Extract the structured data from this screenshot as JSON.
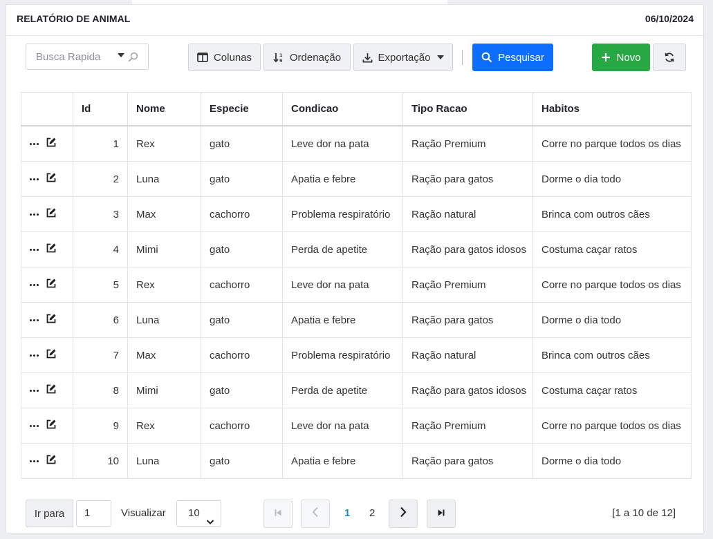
{
  "header": {
    "title": "RELATÓRIO DE ANIMAL",
    "date": "06/10/2024"
  },
  "toolbar": {
    "search_placeholder": "Busca Rapida",
    "columns_label": "Colunas",
    "order_label": "Ordenação",
    "export_label": "Exportação",
    "search_label": "Pesquisar",
    "new_label": "Novo"
  },
  "table": {
    "columns": [
      "Id",
      "Nome",
      "Especie",
      "Condicao",
      "Tipo Racao",
      "Habitos"
    ],
    "rows": [
      [
        "1",
        "Rex",
        "gato",
        "Leve dor na pata",
        "Ração Premium",
        "Corre no parque todos os dias"
      ],
      [
        "2",
        "Luna",
        "gato",
        "Apatia e febre",
        "Ração para gatos",
        "Dorme o dia todo"
      ],
      [
        "3",
        "Max",
        "cachorro",
        "Problema respiratório",
        "Ração natural",
        "Brinca com outros cães"
      ],
      [
        "4",
        "Mimi",
        "gato",
        "Perda de apetite",
        "Ração para gatos idosos",
        "Costuma caçar ratos"
      ],
      [
        "5",
        "Rex",
        "cachorro",
        "Leve dor na pata",
        "Ração Premium",
        "Corre no parque todos os dias"
      ],
      [
        "6",
        "Luna",
        "gato",
        "Apatia e febre",
        "Ração para gatos",
        "Dorme o dia todo"
      ],
      [
        "7",
        "Max",
        "cachorro",
        "Problema respiratório",
        "Ração natural",
        "Brinca com outros cães"
      ],
      [
        "8",
        "Mimi",
        "gato",
        "Perda de apetite",
        "Ração para gatos idosos",
        "Costuma caçar ratos"
      ],
      [
        "9",
        "Rex",
        "cachorro",
        "Leve dor na pata",
        "Ração Premium",
        "Corre no parque todos os dias"
      ],
      [
        "10",
        "Luna",
        "gato",
        "Apatia e febre",
        "Ração para gatos",
        "Dorme o dia todo"
      ]
    ]
  },
  "pager": {
    "goto_label": "Ir para",
    "goto_value": "1",
    "view_label": "Visualizar",
    "page_size": "10",
    "pages": [
      "1",
      "2"
    ],
    "current_page": "1",
    "range_text": "[1 a 10 de 12]"
  },
  "colors": {
    "primary": "#0d6efd",
    "success": "#28a745",
    "active_page": "#1a8cd8"
  },
  "icons": {
    "search": "magnifier-icon",
    "columns": "columns-icon",
    "order": "sort-icon",
    "export": "download-icon",
    "new": "plus-icon",
    "refresh": "refresh-icon",
    "row_more": "ellipsis-icon",
    "row_edit": "edit-icon"
  }
}
